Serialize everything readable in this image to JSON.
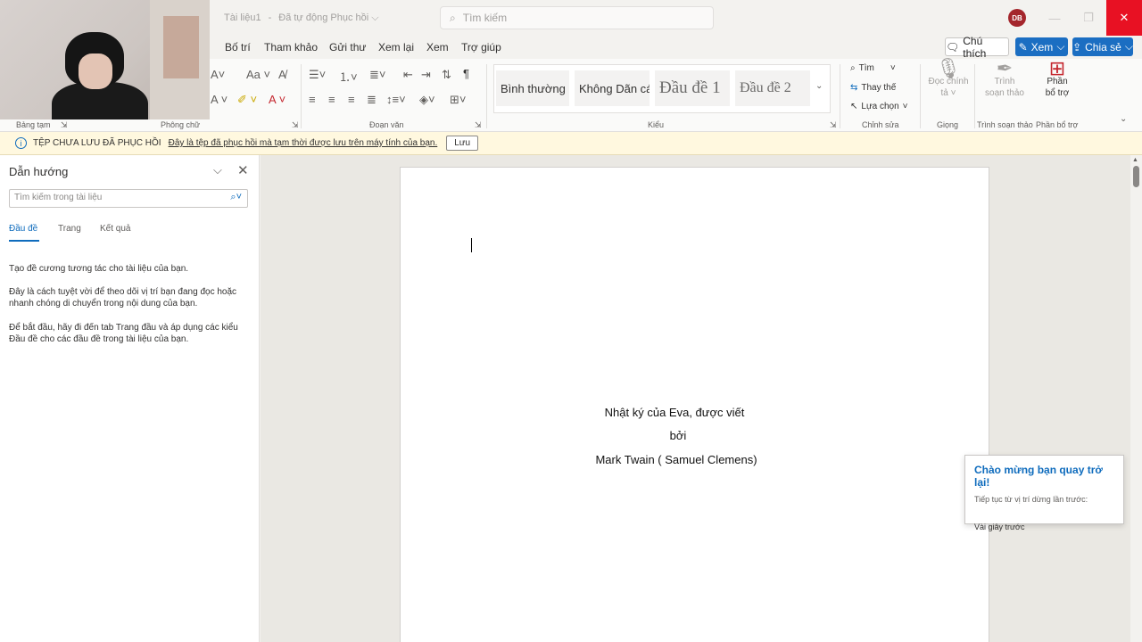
{
  "titlebar": {
    "doc_name": "Tài liệu1",
    "save_status": "Đã tự động Phục hồi",
    "search_placeholder": "Tìm kiếm",
    "avatar_initials": "DB",
    "min_glyph": "—",
    "max_glyph": "❐",
    "close_glyph": "✕"
  },
  "menu": {
    "tabs": [
      "Bố trí",
      "Tham khảo",
      "Gửi thư",
      "Xem lại",
      "Xem",
      "Trợ giúp"
    ],
    "comment_label": "Chú thích",
    "view_label": "Xem",
    "share_label": "Chia sẻ"
  },
  "ribbon": {
    "groups": {
      "clipboard": "Bảng tạm",
      "font": "Phông chữ",
      "paragraph": "Đoạn văn",
      "styles": "Kiểu",
      "editing": "Chỉnh sửa",
      "voice": "Giọng",
      "editor": "Trình soạn thảo",
      "addins": "Phần bổ trợ"
    },
    "styles": [
      "Bình thường",
      "Không Dãn cách",
      "Đầu đề 1",
      "Đầu đề 2"
    ],
    "find_label": "Tìm",
    "replace_label": "Thay thế",
    "select_label": "Lựa chọn",
    "dictate_label_1": "Đọc chính",
    "dictate_label_2": "tả",
    "editor_label_1": "Trình",
    "editor_label_2": "soạn thảo",
    "addins_label_1": "Phần",
    "addins_label_2": "bổ trợ"
  },
  "infobar": {
    "title": "TỆP CHƯA LƯU ĐÃ PHỤC HỒI",
    "message": "Đây là tệp đã phục hồi mà tạm thời được lưu trên máy tính của bạn.",
    "save_button": "Lưu"
  },
  "navpane": {
    "title": "Dẫn hướng",
    "search_placeholder": "Tìm kiếm trong tài liệu",
    "tabs": [
      "Đầu đề",
      "Trang",
      "Kết quả"
    ],
    "para1": "Tạo đề cương tương tác cho tài liệu của bạn.",
    "para2": "Đây là cách tuyệt vời để theo dõi vị trí bạn đang đọc hoặc nhanh chóng di chuyển trong nội dung của bạn.",
    "para3": "Để bắt đầu, hãy đi đến tab Trang đầu và áp dụng các kiểu Đầu đề cho các đầu đề trong tài liệu của bạn."
  },
  "document": {
    "line1": "Nhật ký của Eva, được viết",
    "line2": "bởi",
    "line3": "Mark Twain ( Samuel Clemens)"
  },
  "welcome": {
    "title": "Chào mừng bạn quay trở lại!",
    "subtitle": "Tiếp tục từ vị trí dừng lần trước:",
    "time": "Vài giây trước"
  },
  "colors": {
    "accent": "#0f6cbd",
    "share_button": "#1b6ec2",
    "close_button": "#e81123",
    "infobar": "#fff8df",
    "avatar": "#a4262c"
  }
}
